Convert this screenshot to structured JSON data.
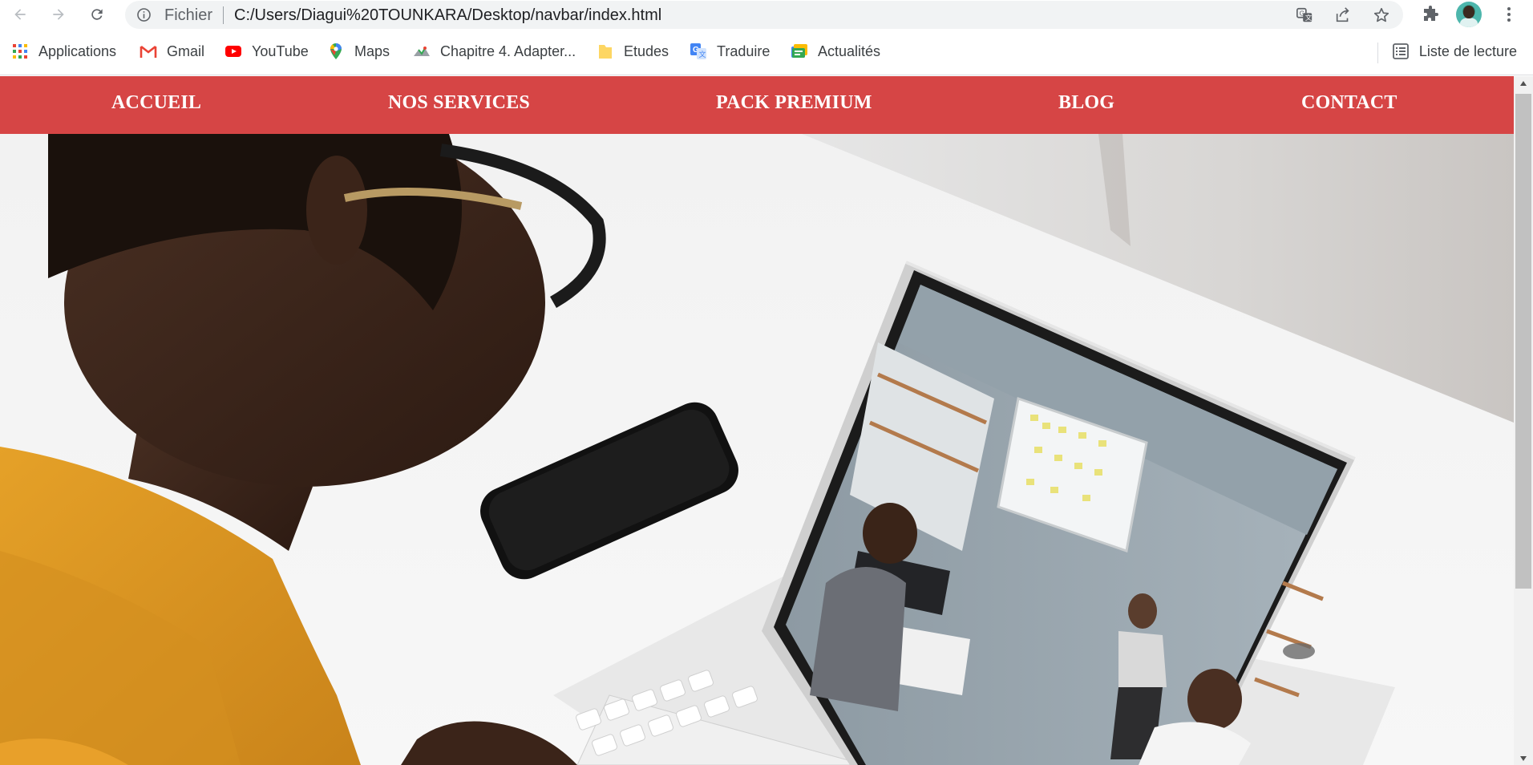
{
  "browser": {
    "address": {
      "scheme_label": "Fichier",
      "url": "C:/Users/Diagui%20TOUNKARA/Desktop/navbar/index.html"
    },
    "bookmarks": [
      {
        "label": "Applications",
        "icon": "apps-grid-icon"
      },
      {
        "label": "Gmail",
        "icon": "gmail-icon"
      },
      {
        "label": "YouTube",
        "icon": "youtube-icon"
      },
      {
        "label": "Maps",
        "icon": "maps-pin-icon"
      },
      {
        "label": "Chapitre 4. Adapter...",
        "icon": "site-icon"
      },
      {
        "label": "Etudes",
        "icon": "folder-icon"
      },
      {
        "label": "Traduire",
        "icon": "translate-icon"
      },
      {
        "label": "Actualités",
        "icon": "news-icon"
      }
    ],
    "reading_list": "Liste de lecture"
  },
  "site": {
    "nav": [
      {
        "label": "ACCUEIL"
      },
      {
        "label": "NOS SERVICES"
      },
      {
        "label": "PACK PREMIUM"
      },
      {
        "label": "BLOG"
      },
      {
        "label": "CONTACT"
      }
    ],
    "nav_color": "#d64545",
    "hero_image": "woman-at-laptop-video-meeting-photo"
  }
}
